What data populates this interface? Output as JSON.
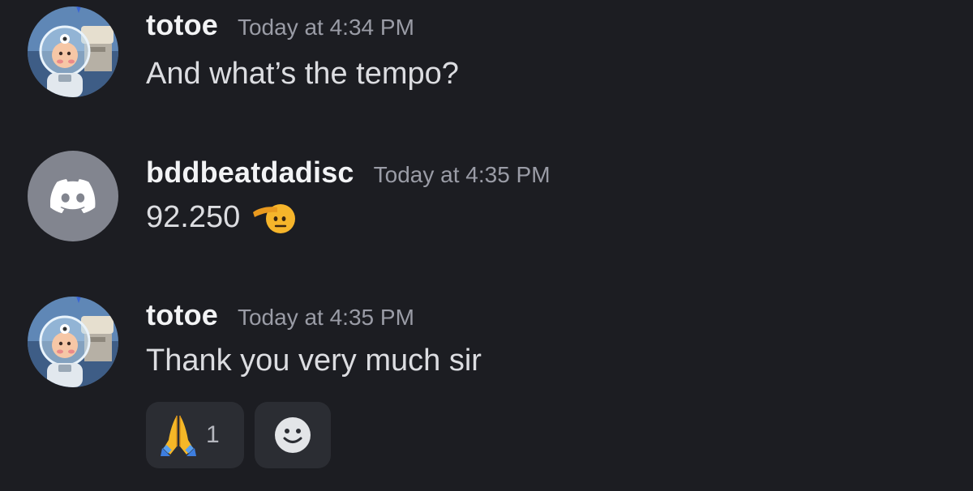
{
  "messages": [
    {
      "username": "totoe",
      "timestamp": "Today at 4:34 PM",
      "text": "And what’s the tempo?",
      "avatar": "astronaut-character-avatar"
    },
    {
      "username": "bddbeatdadisc",
      "timestamp": "Today at 4:35 PM",
      "text": "92.250",
      "avatar": "discord-logo-icon",
      "emoji": "saluting-face-emoji"
    },
    {
      "username": "totoe",
      "timestamp": "Today at 4:35 PM",
      "text": "Thank you very much sir",
      "avatar": "astronaut-character-avatar"
    }
  ],
  "reactions": [
    {
      "emoji": "folded-hands-emoji",
      "count": "1"
    },
    {
      "icon": "add-reaction-smiley-icon"
    }
  ],
  "colors": {
    "background": "#1c1d22",
    "username": "#f2f3f5",
    "timestamp": "#9a9ca6",
    "message_text": "#dcdde1",
    "reaction_bg": "#2b2d33",
    "discord_avatar_bg": "#82858f"
  }
}
